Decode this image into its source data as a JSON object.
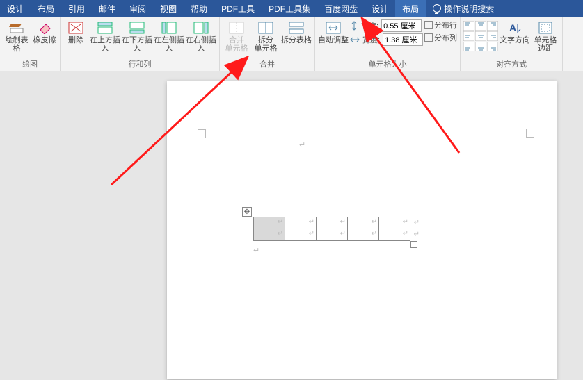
{
  "tabs": {
    "items": [
      {
        "label": "设计"
      },
      {
        "label": "布局"
      },
      {
        "label": "引用"
      },
      {
        "label": "邮件"
      },
      {
        "label": "审阅"
      },
      {
        "label": "视图"
      },
      {
        "label": "帮助"
      },
      {
        "label": "PDF工具"
      },
      {
        "label": "PDF工具集"
      },
      {
        "label": "百度网盘"
      }
    ],
    "context": [
      {
        "label": "设计"
      },
      {
        "label": "布局"
      }
    ],
    "search_placeholder": "操作说明搜索"
  },
  "ribbon": {
    "groups": {
      "draw": {
        "label": "绘图",
        "btn_draw": "绘制表格",
        "btn_eraser": "橡皮擦"
      },
      "rowscols": {
        "label": "行和列",
        "btn_delete": "删除",
        "btn_insert_above": "在上方插入",
        "btn_insert_below": "在下方插入",
        "btn_insert_left": "在左侧插入",
        "btn_insert_right": "在右侧插入"
      },
      "merge": {
        "label": "合并",
        "btn_merge": "合并\n单元格",
        "btn_split_cell": "拆分\n单元格",
        "btn_split_table": "拆分表格"
      },
      "cellsize": {
        "label": "单元格大小",
        "btn_autofit": "自动调整",
        "height_label": "高度:",
        "height_value": "0.55 厘米",
        "width_label": "宽度:",
        "width_value": "1.38 厘米",
        "dist_rows": "分布行",
        "dist_cols": "分布列"
      },
      "align": {
        "label": "对齐方式",
        "btn_textdir": "文字方向",
        "btn_margins": "单元格\n边距"
      }
    }
  },
  "table": {
    "rows": 2,
    "cols": 5,
    "selected": [
      [
        0,
        0
      ],
      [
        1,
        0
      ]
    ]
  }
}
